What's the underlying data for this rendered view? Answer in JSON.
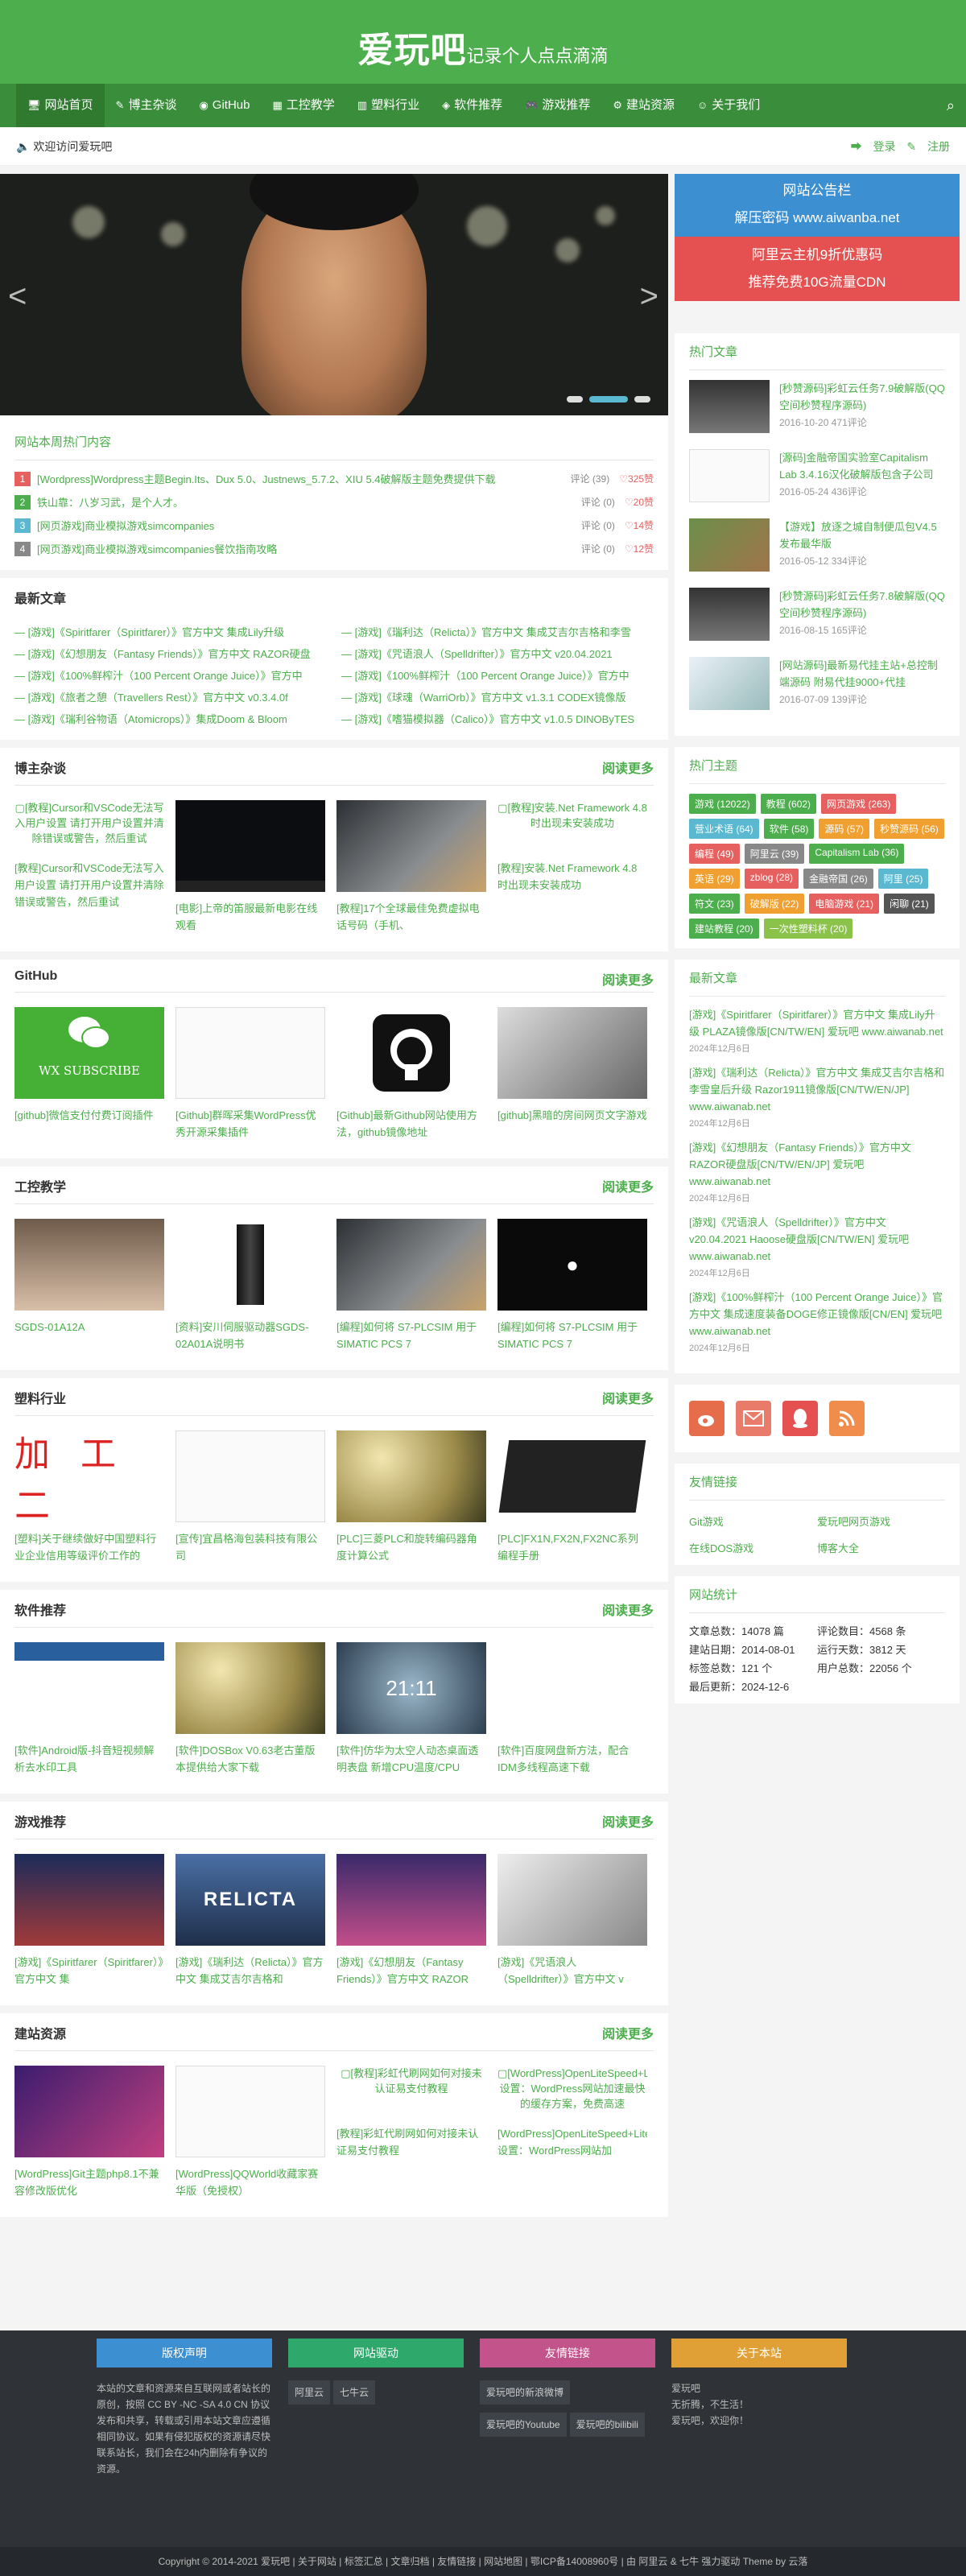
{
  "header": {
    "logo_big": "爱玩吧",
    "logo_small": "记录个人点点滴滴"
  },
  "nav": {
    "items": [
      "网站首页",
      "博主杂谈",
      "GitHub",
      "工控教学",
      "塑料行业",
      "软件推荐",
      "游戏推荐",
      "建站资源",
      "关于我们"
    ],
    "search_icon": "search-icon"
  },
  "welcome": {
    "text": "欢迎访问爱玩吧",
    "login": "登录",
    "register": "注册"
  },
  "hot_week": {
    "title": "网站本周热门内容",
    "rows": [
      {
        "num": "1",
        "color": "#e76060",
        "title": "[Wordpress]Wordpress主题Begin.Its、Dux 5.0、Justnews_5.7.2、XIU 5.4破解版主题免费提供下载",
        "comments": "评论 (39)",
        "likes": "325赞"
      },
      {
        "num": "2",
        "color": "#4cae4c",
        "title": "铁山靠：八岁习武，是个人才。",
        "comments": "评论 (0)",
        "likes": "20赞"
      },
      {
        "num": "3",
        "color": "#5ab9d0",
        "title": "[网页游戏]商业模拟游戏simcompanies",
        "comments": "评论 (0)",
        "likes": "14赞"
      },
      {
        "num": "4",
        "color": "#888888",
        "title": "[网页游戏]商业模拟游戏simcompanies餐饮指南攻略",
        "comments": "评论 (0)",
        "likes": "12赞"
      }
    ]
  },
  "latest": {
    "title": "最新文章",
    "left": [
      "[游戏]《Spiritfarer（Spiritfarer）》官方中文 集成Lily升级",
      "[游戏]《幻想朋友（Fantasy Friends）》官方中文 RAZOR硬盘",
      "[游戏]《100%鲜榨汁（100 Percent Orange Juice）》官方中",
      "[游戏]《旅者之憩（Travellers Rest）》官方中文 v0.3.4.0f",
      "[游戏]《瑞利谷物语（Atomicrops）》集成Doom & Bloom"
    ],
    "right": [
      "[游戏]《瑞利达（Relicta）》官方中文 集成艾吉尔吉格和李雪",
      "[游戏]《咒语浪人（Spelldrifter）》官方中文 v20.04.2021",
      "[游戏]《100%鲜榨汁（100 Percent Orange Juice）》官方中",
      "[游戏]《球魂（WarriOrb）》官方中文 v1.3.1 CODEX镜像版",
      "[游戏]《嗜猫模拟器（Calico）》官方中文 v1.0.5 DINOByTES"
    ]
  },
  "sections": [
    {
      "title": "博主杂谈",
      "more": "阅读更多",
      "cards": [
        {
          "text": "[教程]Cursor和VSCode无法写入用户设置 请打开用户设置并清除错误或警告，然后重试",
          "thumb": "broken",
          "alt": "[教程]Cursor和VSCode无法写入用户设置 请打开用户设置并清除错误或警告，然后重试"
        },
        {
          "text": "[电影]上帝的笛服最新电影在线观看",
          "thumb": "video"
        },
        {
          "text": "[教程]17个全球最佳免费虚拟电话号码（手机、",
          "thumb": "mixer"
        },
        {
          "text": "[教程]安装.Net Framework 4.8 时出现未安装成功",
          "thumb": "broken",
          "alt": "[教程]安装.Net Framework 4.8 时出现未安装成功"
        }
      ]
    },
    {
      "title": "GitHub",
      "more": "阅读更多",
      "cards": [
        {
          "text": "[github]微信支付付费订阅插件",
          "thumb": "wechat",
          "label": "WX SUBSCRIBE"
        },
        {
          "text": "[Github]群晖采集WordPress优秀开源采集插件",
          "thumb": "doc"
        },
        {
          "text": "[Github]最新Github网站使用方法，github镜像地址",
          "thumb": "github"
        },
        {
          "text": "[github]黑暗的房间网页文字游戏",
          "thumb": "phone"
        }
      ]
    },
    {
      "title": "工控教学",
      "more": "阅读更多",
      "cards": [
        {
          "text": "SGDS-01A12A",
          "thumb": "cat"
        },
        {
          "text": "[资料]安川伺服驱动器SGDS-02A01A说明书",
          "thumb": "servo"
        },
        {
          "text": "[编程]如何将 S7-PLCSIM 用于 SIMATIC PCS 7",
          "thumb": "mixer"
        },
        {
          "text": "[编程]如何将 S7-PLCSIM 用于 SIMATIC PCS 7",
          "thumb": "laptop"
        }
      ]
    },
    {
      "title": "塑料行业",
      "more": "阅读更多",
      "cards": [
        {
          "text": "[塑料]关于继续做好中国塑料行业企业信用等级评价工作的",
          "thumb": "jiagong",
          "label": "加 工 二"
        },
        {
          "text": "[宣传]宜昌格海包装科技有限公司",
          "thumb": "doc"
        },
        {
          "text": "[PLC]三菱PLC和旋转编码器角度计算公式",
          "thumb": "grass"
        },
        {
          "text": "[PLC]FX1N,FX2N,FX2NC系列编程手册",
          "thumb": "book"
        }
      ]
    },
    {
      "title": "软件推荐",
      "more": "阅读更多",
      "cards": [
        {
          "text": "[软件]Android版-抖音短视频解析去水印工具",
          "thumb": "screen"
        },
        {
          "text": "[软件]DOSBox V0.63老古董版本提供给大家下载",
          "thumb": "grass"
        },
        {
          "text": "[软件]仿华为太空人动态桌面透明表盘 新增CPU温度/CPU",
          "thumb": "gauge",
          "label": "21:11"
        },
        {
          "text": "[软件]百度网盘新方法，配合IDM多线程高速下载",
          "thumb": "textdoc"
        }
      ]
    },
    {
      "title": "游戏推荐",
      "more": "阅读更多",
      "cards": [
        {
          "text": "[游戏]《Spiritfarer（Spiritfarer）》官方中文 集",
          "thumb": "boat"
        },
        {
          "text": "[游戏]《瑞利达（Relicta）》官方中文 集成艾吉尔吉格和",
          "thumb": "relicta",
          "label": "RELICTA"
        },
        {
          "text": "[游戏]《幻想朋友（Fantasy Friends）》官方中文 RAZOR",
          "thumb": "purple"
        },
        {
          "text": "[游戏]《咒语浪人（Spelldrifter）》官方中文 v",
          "thumb": "laptop2"
        }
      ]
    },
    {
      "title": "建站资源",
      "more": "阅读更多",
      "cards": [
        {
          "text": "[WordPress]Git主题php8.1不兼容修改版优化",
          "thumb": "gitpurple"
        },
        {
          "text": "[WordPress]QQWorld收藏家赛华版（免授权）",
          "thumb": "doc"
        },
        {
          "text": "[教程]彩虹代刷网如何对接未认证易支付教程",
          "thumb": "broken",
          "alt": "[教程]彩虹代刷网如何对接未认证易支付教程"
        },
        {
          "text": "[WordPress]OpenLiteSpeed+Litecache设置：WordPress网站加",
          "thumb": "broken",
          "alt": "[WordPress]OpenLiteSpeed+LiteSpeedcache设置：WordPress网站加速最快的缓存方案，免费高速"
        }
      ]
    }
  ],
  "notice": {
    "title": "网站公告栏",
    "line1": "解压密码 www.aiwanba.net",
    "line2": "阿里云主机9折优惠码",
    "line3": "推荐免费10G流量CDN"
  },
  "hot_articles": {
    "title": "热门文章",
    "items": [
      {
        "title": "[秒赞源码]彩虹云任务7.9破解版(QQ空间秒赞程序源码)",
        "meta": "2016-10-20   471评论",
        "thumb": "tv"
      },
      {
        "title": "[源码]金融帝国实验室Capitalism Lab 3.4.16汉化破解版包含子公司",
        "meta": "2016-05-24   436评论",
        "thumb": "doc"
      },
      {
        "title": "【游戏】放逐之城自制便瓜包V4.5发布最华版",
        "meta": "2016-05-12   334评论",
        "thumb": "game"
      },
      {
        "title": "[秒赞源码]彩虹云任务7.8破解版(QQ空间秒赞程序源码)",
        "meta": "2016-08-15   165评论",
        "thumb": "tv"
      },
      {
        "title": "[网站源码]最新易代挂主站+总控制端源码 附易代挂9000+代挂",
        "meta": "2016-07-09   139评论",
        "thumb": "mobile"
      }
    ]
  },
  "hot_tags": {
    "title": "热门主题",
    "tags": [
      {
        "label": "游戏 (12022)",
        "color": "#4cae4c"
      },
      {
        "label": "教程 (602)",
        "color": "#4cae4c"
      },
      {
        "label": "网页游戏 (263)",
        "color": "#e76060"
      },
      {
        "label": "营业术语 (64)",
        "color": "#5ab9d0"
      },
      {
        "label": "软件 (58)",
        "color": "#4cae4c"
      },
      {
        "label": "源码 (57)",
        "color": "#f0a030"
      },
      {
        "label": "秒赞源码 (56)",
        "color": "#f0a030"
      },
      {
        "label": "编程 (49)",
        "color": "#e76060"
      },
      {
        "label": "阿里云 (39)",
        "color": "#888888"
      },
      {
        "label": "Capitalism Lab (36)",
        "color": "#4cae4c"
      },
      {
        "label": "英语 (29)",
        "color": "#f0a030"
      },
      {
        "label": "zblog (28)",
        "color": "#e76060"
      },
      {
        "label": "金融帝国 (26)",
        "color": "#888888"
      },
      {
        "label": "阿里 (25)",
        "color": "#5ab9d0"
      },
      {
        "label": "符文 (23)",
        "color": "#4cae4c"
      },
      {
        "label": "破解版 (22)",
        "color": "#f0a030"
      },
      {
        "label": "电脑游戏 (21)",
        "color": "#e76060"
      },
      {
        "label": "闲聊 (21)",
        "color": "#555555"
      },
      {
        "label": "建站教程 (20)",
        "color": "#4cae4c"
      },
      {
        "label": "一次性塑料杯 (20)",
        "color": "#8bc34a"
      }
    ]
  },
  "new_articles": {
    "title": "最新文章",
    "items": [
      {
        "title": "[游戏]《Spiritfarer（Spiritfarer）》官方中文 集成Lily升级 PLAZA镜像版[CN/TW/EN] 爱玩吧 www.aiwanab.net",
        "date": "2024年12月6日"
      },
      {
        "title": "[游戏]《瑞利达（Relicta）》官方中文 集成艾吉尔吉格和李雪皇后升级 Razor1911镜像版[CN/TW/EN/JP] www.aiwanab.net",
        "date": "2024年12月6日"
      },
      {
        "title": "[游戏]《幻想朋友（Fantasy Friends）》官方中文 RAZOR硬盘版[CN/TW/EN/JP] 爱玩吧 www.aiwanab.net",
        "date": "2024年12月6日"
      },
      {
        "title": "[游戏]《咒语浪人（Spelldrifter）》官方中文 v20.04.2021 Haoose硬盘版[CN/TW/EN] 爱玩吧 www.aiwanab.net",
        "date": "2024年12月6日"
      },
      {
        "title": "[游戏]《100%鲜榨汁（100 Percent Orange Juice）》官方中文 集成速度装备DOGE修正镜像版[CN/EN] 爱玩吧 www.aiwanab.net",
        "date": "2024年12月6日"
      }
    ]
  },
  "links": {
    "title": "友情链接",
    "items": [
      "Git游戏",
      "爱玩吧网页游戏",
      "在线DOS游戏",
      "博客大全"
    ]
  },
  "stats": {
    "title": "网站统计",
    "items": [
      "文章总数：14078 篇",
      "评论数目：4568 条",
      "建站日期：2014-08-01",
      "运行天数：3812 天",
      "标签总数：121 个",
      "用户总数：22056 个",
      "最后更新：2024-12-6",
      ""
    ]
  },
  "footer": {
    "col1": {
      "head": "版权声明",
      "color": "#3c8fd0",
      "body": "本站的文章和资源来自互联网或者站长的原创，按照 CC BY -NC -SA 4.0 CN 协议发布和共享，转载或引用本站文章应遵循相同协议。如果有侵犯版权的资源请尽快联系站长，我们会在24h内删除有争议的资源。"
    },
    "col2": {
      "head": "网站驱动",
      "color": "#2fa86b",
      "chips": [
        "阿里云",
        "七牛云"
      ]
    },
    "col3": {
      "head": "友情链接",
      "color": "#c2548b",
      "chips": [
        "爱玩吧的新浪微博",
        "爱玩吧的Youtube",
        "爱玩吧的bilibili"
      ]
    },
    "col4": {
      "head": "关于本站",
      "color": "#e0a035",
      "body": "爱玩吧\n无折腾，不生活！\n爱玩吧，欢迎你！"
    },
    "copyright": "Copyright © 2014-2021 爱玩吧 | 关于网站 | 标签汇总 | 文章归档 | 友情链接 | 网站地图 | 鄂ICP备14008960号 | 由 阿里云 & 七牛 强力驱动 Theme by 云落"
  }
}
